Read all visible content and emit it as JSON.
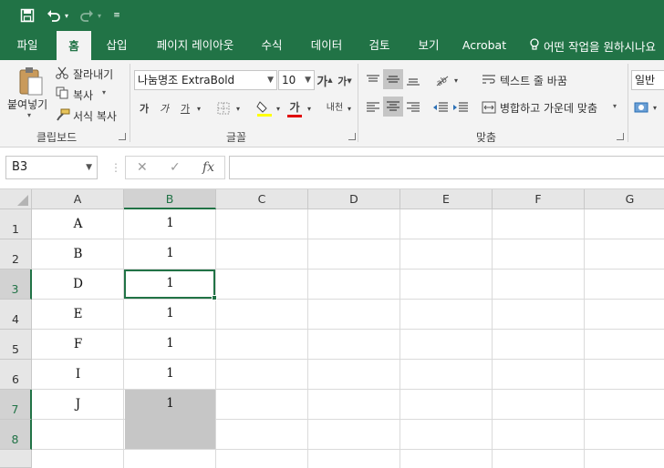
{
  "quick_access": {
    "save_icon": "save-icon",
    "undo_icon": "undo-icon",
    "redo_icon": "redo-icon",
    "customize_icon": "customize-qat-icon"
  },
  "tabs": [
    {
      "label": "파일"
    },
    {
      "label": "홈"
    },
    {
      "label": "삽입"
    },
    {
      "label": "페이지 레이아웃"
    },
    {
      "label": "수식"
    },
    {
      "label": "데이터"
    },
    {
      "label": "검토"
    },
    {
      "label": "보기"
    },
    {
      "label": "Acrobat"
    },
    {
      "label": "어떤 작업을 원하시나요"
    }
  ],
  "ribbon": {
    "clipboard": {
      "paste": "붙여넣기",
      "cut": "잘라내기",
      "copy": "복사",
      "format_painter": "서식 복사",
      "group_label": "클립보드"
    },
    "font": {
      "font_name": "나눔명조 ExtraBold",
      "font_size": "10",
      "grow": "가",
      "shrink": "가",
      "bold": "가",
      "italic": "가",
      "underline": "가",
      "font_color_glyph": "가",
      "phonetic": "내천",
      "group_label": "글꼴"
    },
    "alignment": {
      "wrap_text": "텍스트 줄 바꿈",
      "merge_center": "병합하고 가운데 맞춤",
      "group_label": "맞춤"
    },
    "number": {
      "format": "일반"
    }
  },
  "formula_bar": {
    "name_box": "B3",
    "fx_label": "fx",
    "formula": ""
  },
  "grid": {
    "columns": [
      "A",
      "B",
      "C",
      "D",
      "E",
      "F",
      "G"
    ],
    "rows": [
      {
        "num": "1",
        "a": "A",
        "b": "1"
      },
      {
        "num": "2",
        "a": "B",
        "b": "1"
      },
      {
        "num": "3",
        "a": "D",
        "b": "1"
      },
      {
        "num": "4",
        "a": "E",
        "b": "1"
      },
      {
        "num": "5",
        "a": "F",
        "b": "1"
      },
      {
        "num": "6",
        "a": "I",
        "b": "1"
      },
      {
        "num": "7",
        "a": "J",
        "b": "1"
      },
      {
        "num": "8",
        "a": "",
        "b": ""
      }
    ]
  },
  "colors": {
    "accent": "#217346",
    "selection_fill": "#c6c6c6",
    "font_color_underline": "#e00000",
    "highlight_underline": "#ffff00"
  }
}
